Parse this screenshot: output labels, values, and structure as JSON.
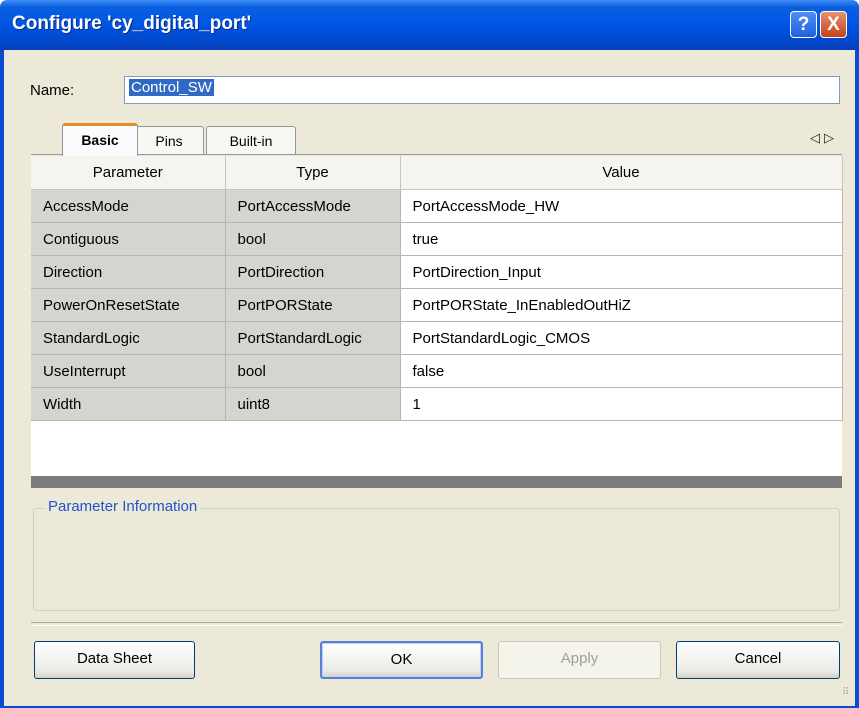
{
  "window": {
    "title": "Configure 'cy_digital_port'",
    "help_glyph": "?",
    "close_glyph": "X"
  },
  "name_field": {
    "label": "Name:",
    "value": "Control_SW"
  },
  "tabs": [
    {
      "label": "Basic",
      "active": true
    },
    {
      "label": "Pins",
      "active": false
    },
    {
      "label": "Built-in",
      "active": false
    }
  ],
  "tab_scroll": {
    "left_glyph": "◁",
    "right_glyph": "▷"
  },
  "grid": {
    "columns": [
      "Parameter",
      "Type",
      "Value"
    ],
    "rows": [
      {
        "parameter": "AccessMode",
        "type": "PortAccessMode",
        "value": "PortAccessMode_HW"
      },
      {
        "parameter": "Contiguous",
        "type": "bool",
        "value": "true"
      },
      {
        "parameter": "Direction",
        "type": "PortDirection",
        "value": "PortDirection_Input"
      },
      {
        "parameter": "PowerOnResetState",
        "type": "PortPORState",
        "value": "PortPORState_InEnabledOutHiZ"
      },
      {
        "parameter": "StandardLogic",
        "type": "PortStandardLogic",
        "value": "PortStandardLogic_CMOS"
      },
      {
        "parameter": "UseInterrupt",
        "type": "bool",
        "value": "false"
      },
      {
        "parameter": "Width",
        "type": "uint8",
        "value": "1"
      }
    ]
  },
  "info": {
    "legend": "Parameter Information",
    "text": ""
  },
  "buttons": {
    "datasheet": "Data Sheet",
    "ok": "OK",
    "apply": "Apply",
    "cancel": "Cancel"
  },
  "colors": {
    "titlebar": "#0055e5",
    "tab_highlight": "#e68b2c",
    "selection": "#316ac5",
    "legend_text": "#1e55c8"
  }
}
